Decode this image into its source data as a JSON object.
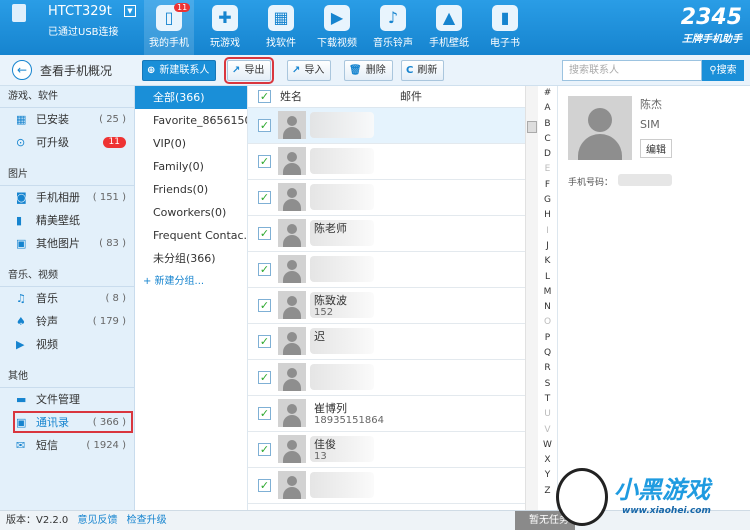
{
  "device": {
    "name": "HTCT329t",
    "status": "已通过USB连接"
  },
  "nav": [
    {
      "label": "我的手机",
      "icon": "phone-icon",
      "badge": "11"
    },
    {
      "label": "玩游戏",
      "icon": "gamepad-icon"
    },
    {
      "label": "找软件",
      "icon": "app-store-icon"
    },
    {
      "label": "下载视频",
      "icon": "video-icon"
    },
    {
      "label": "音乐铃声",
      "icon": "music-icon"
    },
    {
      "label": "手机壁纸",
      "icon": "wallpaper-icon"
    },
    {
      "label": "电子书",
      "icon": "book-icon"
    }
  ],
  "logo": {
    "number": "2345",
    "slogan": "王牌手机助手"
  },
  "toolbar": {
    "back": "查看手机概况",
    "new_contact": "新建联系人",
    "export": "导出",
    "import": "导入",
    "delete": "删除",
    "refresh": "刷新",
    "search_placeholder": "搜索联系人",
    "search": "搜索"
  },
  "sidebar": {
    "sec1": "游戏、软件",
    "installed": "已安装",
    "installed_count": "( 25 )",
    "upgrade": "可升级",
    "upgrade_badge": "11",
    "sec2": "图片",
    "album": "手机相册",
    "album_count": "( 151 )",
    "wallpaper": "精美壁纸",
    "other_pics": "其他图片",
    "other_pics_count": "( 83 )",
    "sec3": "音乐、视频",
    "music": "音乐",
    "music_count": "( 8 )",
    "ringtone": "铃声",
    "ringtone_count": "( 179 )",
    "video": "视频",
    "sec4": "其他",
    "files": "文件管理",
    "contacts": "通讯录",
    "contacts_count": "( 366 )",
    "sms": "短信",
    "sms_count": "( 1924 )"
  },
  "groups": [
    "全部(366)",
    "Favorite_8656150...",
    "VIP(0)",
    "Family(0)",
    "Friends(0)",
    "Coworkers(0)",
    "Frequent Contac...",
    "未分组(366)"
  ],
  "new_group": "+ 新建分组...",
  "list": {
    "col_name": "姓名",
    "col_email": "邮件",
    "rows": [
      {
        "name": "",
        "phone": ""
      },
      {
        "name": "",
        "phone": ""
      },
      {
        "name": "",
        "phone": ""
      },
      {
        "name": "陈老师",
        "phone": ""
      },
      {
        "name": "",
        "phone": ""
      },
      {
        "name": "陈致波",
        "phone": "152"
      },
      {
        "name": "迟",
        "phone": ""
      },
      {
        "name": "",
        "phone": ""
      },
      {
        "name": "崔博列",
        "phone": "18935151864"
      },
      {
        "name": "佳俊",
        "phone": "13"
      },
      {
        "name": "",
        "phone": ""
      }
    ]
  },
  "alphabet": [
    "#",
    "A",
    "B",
    "C",
    "D",
    "E",
    "F",
    "G",
    "H",
    "I",
    "J",
    "K",
    "L",
    "M",
    "N",
    "O",
    "P",
    "Q",
    "R",
    "S",
    "T",
    "U",
    "V",
    "W",
    "X",
    "Y",
    "Z"
  ],
  "alphabet_dim": [
    "E",
    "I",
    "O",
    "U",
    "V"
  ],
  "detail": {
    "name": "陈杰",
    "source": "SIM",
    "edit": "编辑",
    "phone_label": "手机号码："
  },
  "footer": {
    "version_label": "版本：",
    "version": "V2.2.0",
    "feedback": "意见反馈",
    "check_update": "检查升级",
    "status": "暂无任务"
  },
  "watermark": {
    "text": "小黑游戏",
    "url": "www.xiaohei.com"
  }
}
